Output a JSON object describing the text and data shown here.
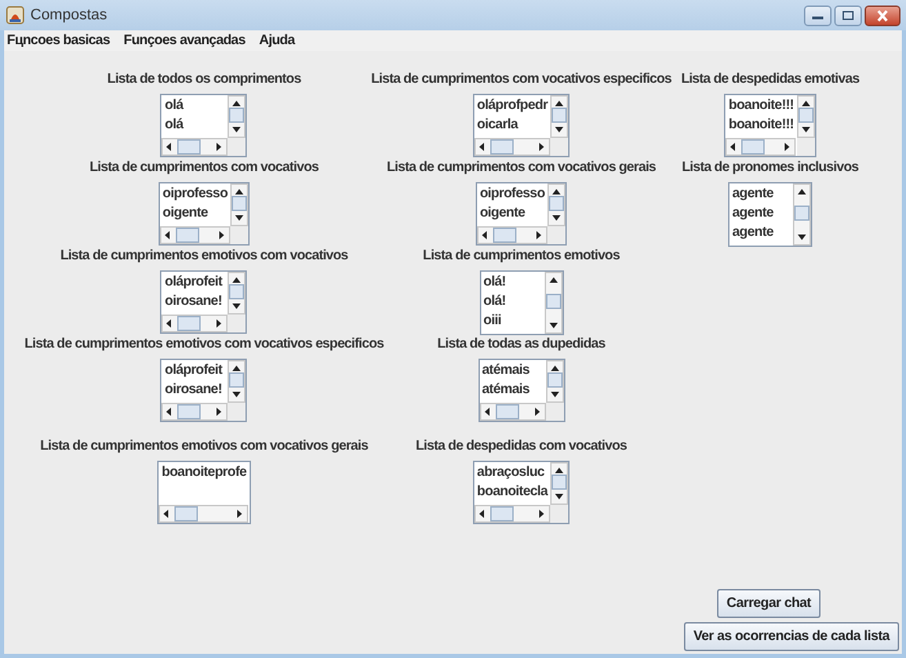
{
  "window": {
    "title": "Compostas"
  },
  "menu": [
    "Fцncoes basicas",
    "Funçoes avançadas",
    "Ajuda"
  ],
  "columns": [
    {
      "lists": [
        {
          "label": "Lista de todos os comprimentos",
          "items": [
            "olá",
            "olá"
          ],
          "vscroll": true,
          "hscroll": true
        },
        {
          "label": "Lista de cumprimentos com vocativos",
          "items": [
            "oiprofesso",
            "oigente"
          ],
          "vscroll": true,
          "hscroll": true
        },
        {
          "label": "Lista de cumprimentos emotivos com vocativos",
          "items": [
            "oláprofeit",
            "oirosane!"
          ],
          "vscroll": true,
          "hscroll": true
        },
        {
          "label": "Lista de cumprimentos emotivos com vocativos especificos",
          "items": [
            "oláprofeit",
            "oirosane!"
          ],
          "vscroll": true,
          "hscroll": true
        },
        {
          "label": "Lista de cumprimentos emotivos com vocativos gerais",
          "items": [
            "boanoiteprofe"
          ],
          "vscroll": false,
          "hscroll": true
        }
      ]
    },
    {
      "lists": [
        {
          "label": "Lista de cumprimentos com vocativos especificos",
          "items": [
            "oláprofpedr",
            "oicarla"
          ],
          "vscroll": true,
          "hscroll": true
        },
        {
          "label": "Lista de cumprimentos com vocativos gerais",
          "items": [
            "oiprofesso",
            "oigente"
          ],
          "vscroll": true,
          "hscroll": true
        },
        {
          "label": "Lista de cumprimentos emotivos",
          "items": [
            "olá!",
            "olá!",
            "oiii"
          ],
          "vscroll": true,
          "hscroll": false
        },
        {
          "label": "Lista de todas as dupedidas",
          "items": [
            "atémais",
            "atémais"
          ],
          "vscroll": true,
          "hscroll": true
        },
        {
          "label": "Lista de despedidas com vocativos",
          "items": [
            "abraçosluc",
            "boanoitecla"
          ],
          "vscroll": true,
          "hscroll": true
        }
      ]
    },
    {
      "lists": [
        {
          "label": "Lista de despedidas emotivas",
          "items": [
            "boanoite!!!",
            "boanoite!!!"
          ],
          "vscroll": true,
          "hscroll": true
        },
        {
          "label": "Lista de pronomes inclusivos",
          "items": [
            "agente",
            "agente",
            "agente"
          ],
          "vscroll": true,
          "hscroll": false
        }
      ]
    }
  ],
  "buttons": [
    "Carregar chat",
    "Ver as ocorrencias de cada lista"
  ]
}
